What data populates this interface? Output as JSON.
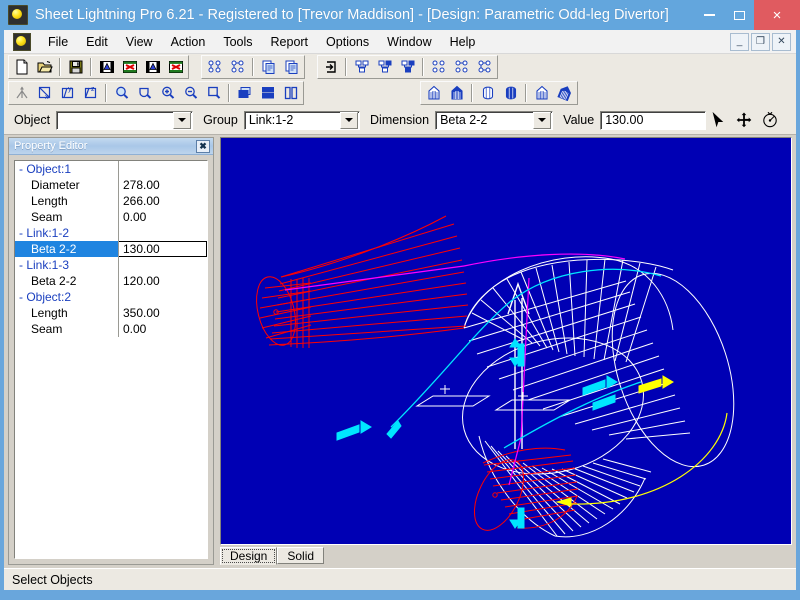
{
  "window": {
    "title": "Sheet Lightning Pro 6.21 - Registered to [Trevor Maddison] - [Design: Parametric Odd-leg Divertor]",
    "app_icon": "lightning-ball-icon",
    "minimize_label": "–",
    "maximize_label": "□",
    "close_label": "×",
    "titlebar_color": "#63a6dd",
    "close_color": "#e05b60"
  },
  "mdi": {
    "minimize_label": "_",
    "restore_label": "❐",
    "close_label": "✕"
  },
  "menu": {
    "items": [
      {
        "label": "File"
      },
      {
        "label": "Edit"
      },
      {
        "label": "View"
      },
      {
        "label": "Action"
      },
      {
        "label": "Tools"
      },
      {
        "label": "Report"
      },
      {
        "label": "Options"
      },
      {
        "label": "Window"
      },
      {
        "label": "Help"
      }
    ]
  },
  "toolbar_top": {
    "groups": [
      {
        "buttons": [
          {
            "icon": "new-document-icon"
          },
          {
            "icon": "open-folder-icon"
          },
          {
            "sep": true
          },
          {
            "icon": "save-disk-icon"
          },
          {
            "sep": true
          },
          {
            "icon": "import-dxf-icon"
          },
          {
            "icon": "import-drawing-icon"
          },
          {
            "icon": "export-dxf-icon"
          },
          {
            "icon": "export-drawing-icon"
          }
        ]
      },
      {
        "buttons": [
          {
            "icon": "unfold-pattern-icon"
          },
          {
            "icon": "nest-pattern-icon"
          },
          {
            "sep": true
          },
          {
            "icon": "copy-icon"
          },
          {
            "icon": "paste-icon"
          }
        ]
      },
      {
        "buttons": [
          {
            "icon": "exit-door-icon"
          },
          {
            "sep": true
          },
          {
            "icon": "link-outline-icon"
          },
          {
            "icon": "link-top-selected-icon"
          },
          {
            "icon": "link-bottom-selected-icon"
          },
          {
            "sep": true
          },
          {
            "icon": "nodes-outline-icon"
          },
          {
            "icon": "nodes-partial-icon"
          },
          {
            "icon": "nodes-linked-icon"
          }
        ]
      }
    ]
  },
  "toolbar_bottom": {
    "groups": [
      {
        "buttons": [
          {
            "icon": "axis-tripod-icon"
          },
          {
            "icon": "rotate-x-icon"
          },
          {
            "icon": "rotate-y-icon"
          },
          {
            "icon": "rotate-z-icon"
          },
          {
            "sep": true
          },
          {
            "icon": "zoom-window-icon"
          },
          {
            "icon": "zoom-fit-icon"
          },
          {
            "icon": "zoom-in-icon"
          },
          {
            "icon": "zoom-out-icon"
          },
          {
            "icon": "zoom-previous-icon"
          },
          {
            "sep": true
          },
          {
            "icon": "tile-cascade-icon"
          },
          {
            "icon": "tile-horizontal-icon"
          },
          {
            "icon": "tile-vertical-icon"
          }
        ]
      },
      {
        "buttons": [
          {
            "icon": "develop-outline-icon"
          },
          {
            "icon": "develop-solid-icon"
          },
          {
            "sep": true
          },
          {
            "icon": "cylinder-outline-icon"
          },
          {
            "icon": "cylinder-solid-icon"
          },
          {
            "sep": true
          },
          {
            "icon": "transition-outline-icon"
          },
          {
            "icon": "transition-solid-icon"
          }
        ]
      }
    ]
  },
  "fieldbar": {
    "object_label": "Object",
    "object_value": "",
    "group_label": "Group",
    "group_value": "Link:1-2",
    "dimension_label": "Dimension",
    "dimension_value": "Beta 2-2",
    "value_label": "Value",
    "value_value": "130.00",
    "mode_buttons": [
      {
        "icon": "select-arrow-icon"
      },
      {
        "icon": "pan-move-icon"
      },
      {
        "icon": "orbit-rotate-icon"
      }
    ]
  },
  "property_editor": {
    "title": "Property Editor",
    "close_label": "✖",
    "rows": [
      {
        "type": "group",
        "name": "- Object:1",
        "value": "",
        "selected": false
      },
      {
        "type": "leaf",
        "name": "Diameter",
        "value": "278.00",
        "selected": false
      },
      {
        "type": "leaf",
        "name": "Length",
        "value": "266.00",
        "selected": false
      },
      {
        "type": "leaf",
        "name": "Seam",
        "value": "0.00",
        "selected": false
      },
      {
        "type": "group",
        "name": "- Link:1-2",
        "value": "",
        "selected": false
      },
      {
        "type": "leaf",
        "name": "Beta 2-2",
        "value": "130.00",
        "selected": true
      },
      {
        "type": "group",
        "name": "- Link:1-3",
        "value": "",
        "selected": false
      },
      {
        "type": "leaf",
        "name": "Beta 2-2",
        "value": "120.00",
        "selected": false
      },
      {
        "type": "group",
        "name": "- Object:2",
        "value": "",
        "selected": false
      },
      {
        "type": "leaf",
        "name": "Length",
        "value": "350.00",
        "selected": false
      },
      {
        "type": "leaf",
        "name": "Seam",
        "value": "0.00",
        "selected": false
      }
    ],
    "selection_color": "#1f84e0",
    "group_text_color": "#1a3fbf"
  },
  "viewport": {
    "background_color": "#0000b4",
    "wire_color": "#ffffff",
    "pattern_color": "#ff0000",
    "seam_color": "#ff00ff",
    "handle_color": "#00e5ff",
    "dim_color": "#ffff00",
    "tabs": [
      {
        "label": "Design",
        "active": true
      },
      {
        "label": "Solid",
        "active": false
      }
    ]
  },
  "statusbar": {
    "text": "Select Objects"
  }
}
